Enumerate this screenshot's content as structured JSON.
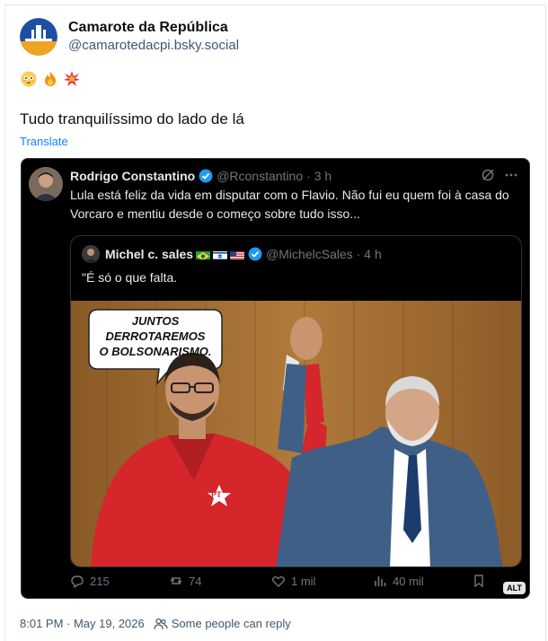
{
  "author": {
    "display_name": "Camarote da República",
    "handle": "@camarotedacpi.bsky.social"
  },
  "emojis": [
    "flushed-face",
    "fire",
    "collision"
  ],
  "post": {
    "text": "Tudo tranquilíssimo do lado de lá",
    "translate_label": "Translate"
  },
  "embed": {
    "tweet": {
      "author_name": "Rodrigo Constantino",
      "handle": "@Rconstantino",
      "time": "· 3 h",
      "text": "Lula está feliz da vida em disputar com o Flavio. Não fui eu quem foi à casa do Vorcaro e mentiu desde o começo sobre tudo isso..."
    },
    "quote": {
      "author_name": "Michel c. sales",
      "handle": "@MichelcSales",
      "time": "· 4 h",
      "text": "\"É só o que falta."
    },
    "image": {
      "speech_bubble": [
        "JUNTOS",
        "DERROTAREMOS",
        "O BOLSONARISMO."
      ],
      "shirt_logo": "PT"
    },
    "stats": {
      "replies": "215",
      "reposts": "74",
      "likes": "1 mil",
      "views": "40 mil"
    },
    "alt_badge": "ALT"
  },
  "meta": {
    "timestamp": "8:01 PM · May 19, 2026",
    "reply_setting": "Some people can reply"
  },
  "colors": {
    "link_blue": "#1083fe",
    "muted_text": "#42576c",
    "tweet_bg": "#000000",
    "x_verified": "#1d9bf0"
  }
}
